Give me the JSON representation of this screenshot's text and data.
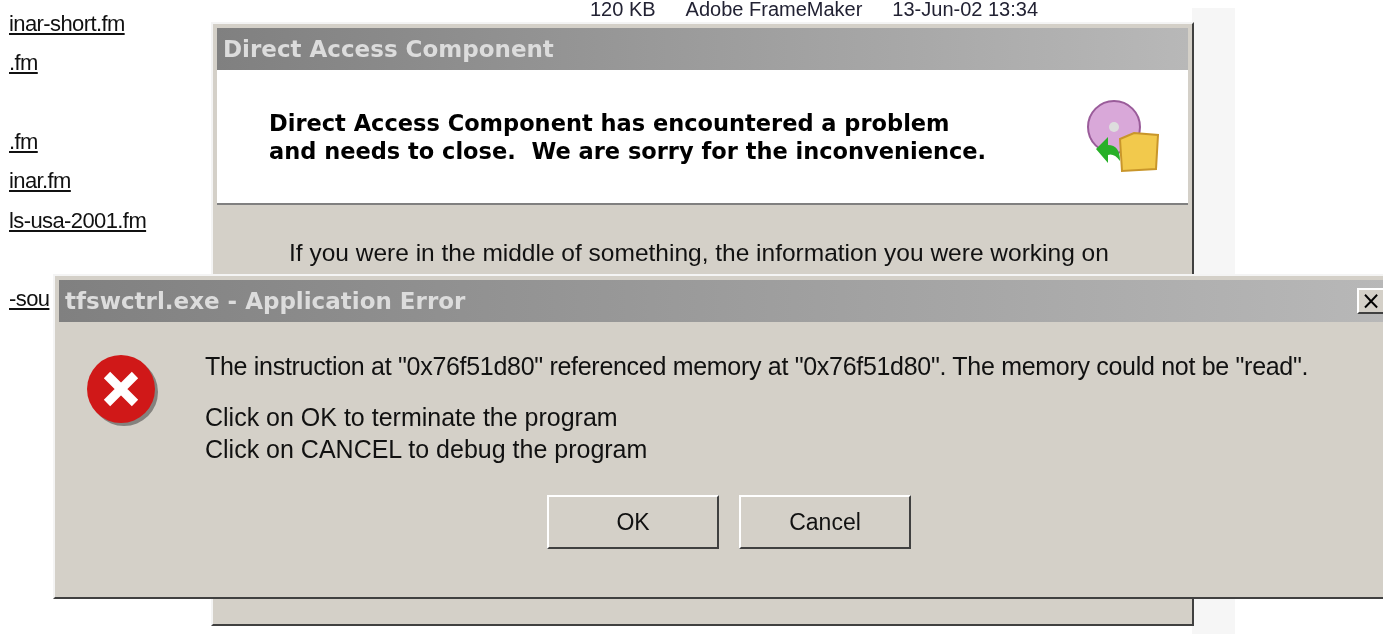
{
  "file_list": {
    "top_row": [
      "120 KB",
      "Adobe FrameMaker",
      "13-Jun-02 13:34"
    ],
    "link_groups": [
      [
        "inar-short.fm",
        ".fm"
      ],
      [
        ".fm",
        "inar.fm",
        "ls-usa-2001.fm"
      ],
      [
        "-sou"
      ]
    ]
  },
  "back_dialog": {
    "title": "Direct Access Component",
    "heading": "Direct Access Component has encountered a problem\nand needs to close.  We are sorry for the inconvenience.",
    "body": "If you were in the middle of something, the information you were working on"
  },
  "error_dialog": {
    "title": "tfswctrl.exe - Application Error",
    "close": "×",
    "message": "The instruction at \"0x76f51d80\" referenced memory at \"0x76f51d80\". The memory could not be \"read\".",
    "lines": [
      "Click on OK to terminate the program",
      "Click on CANCEL to debug the program"
    ],
    "buttons": [
      "OK",
      "Cancel"
    ]
  }
}
